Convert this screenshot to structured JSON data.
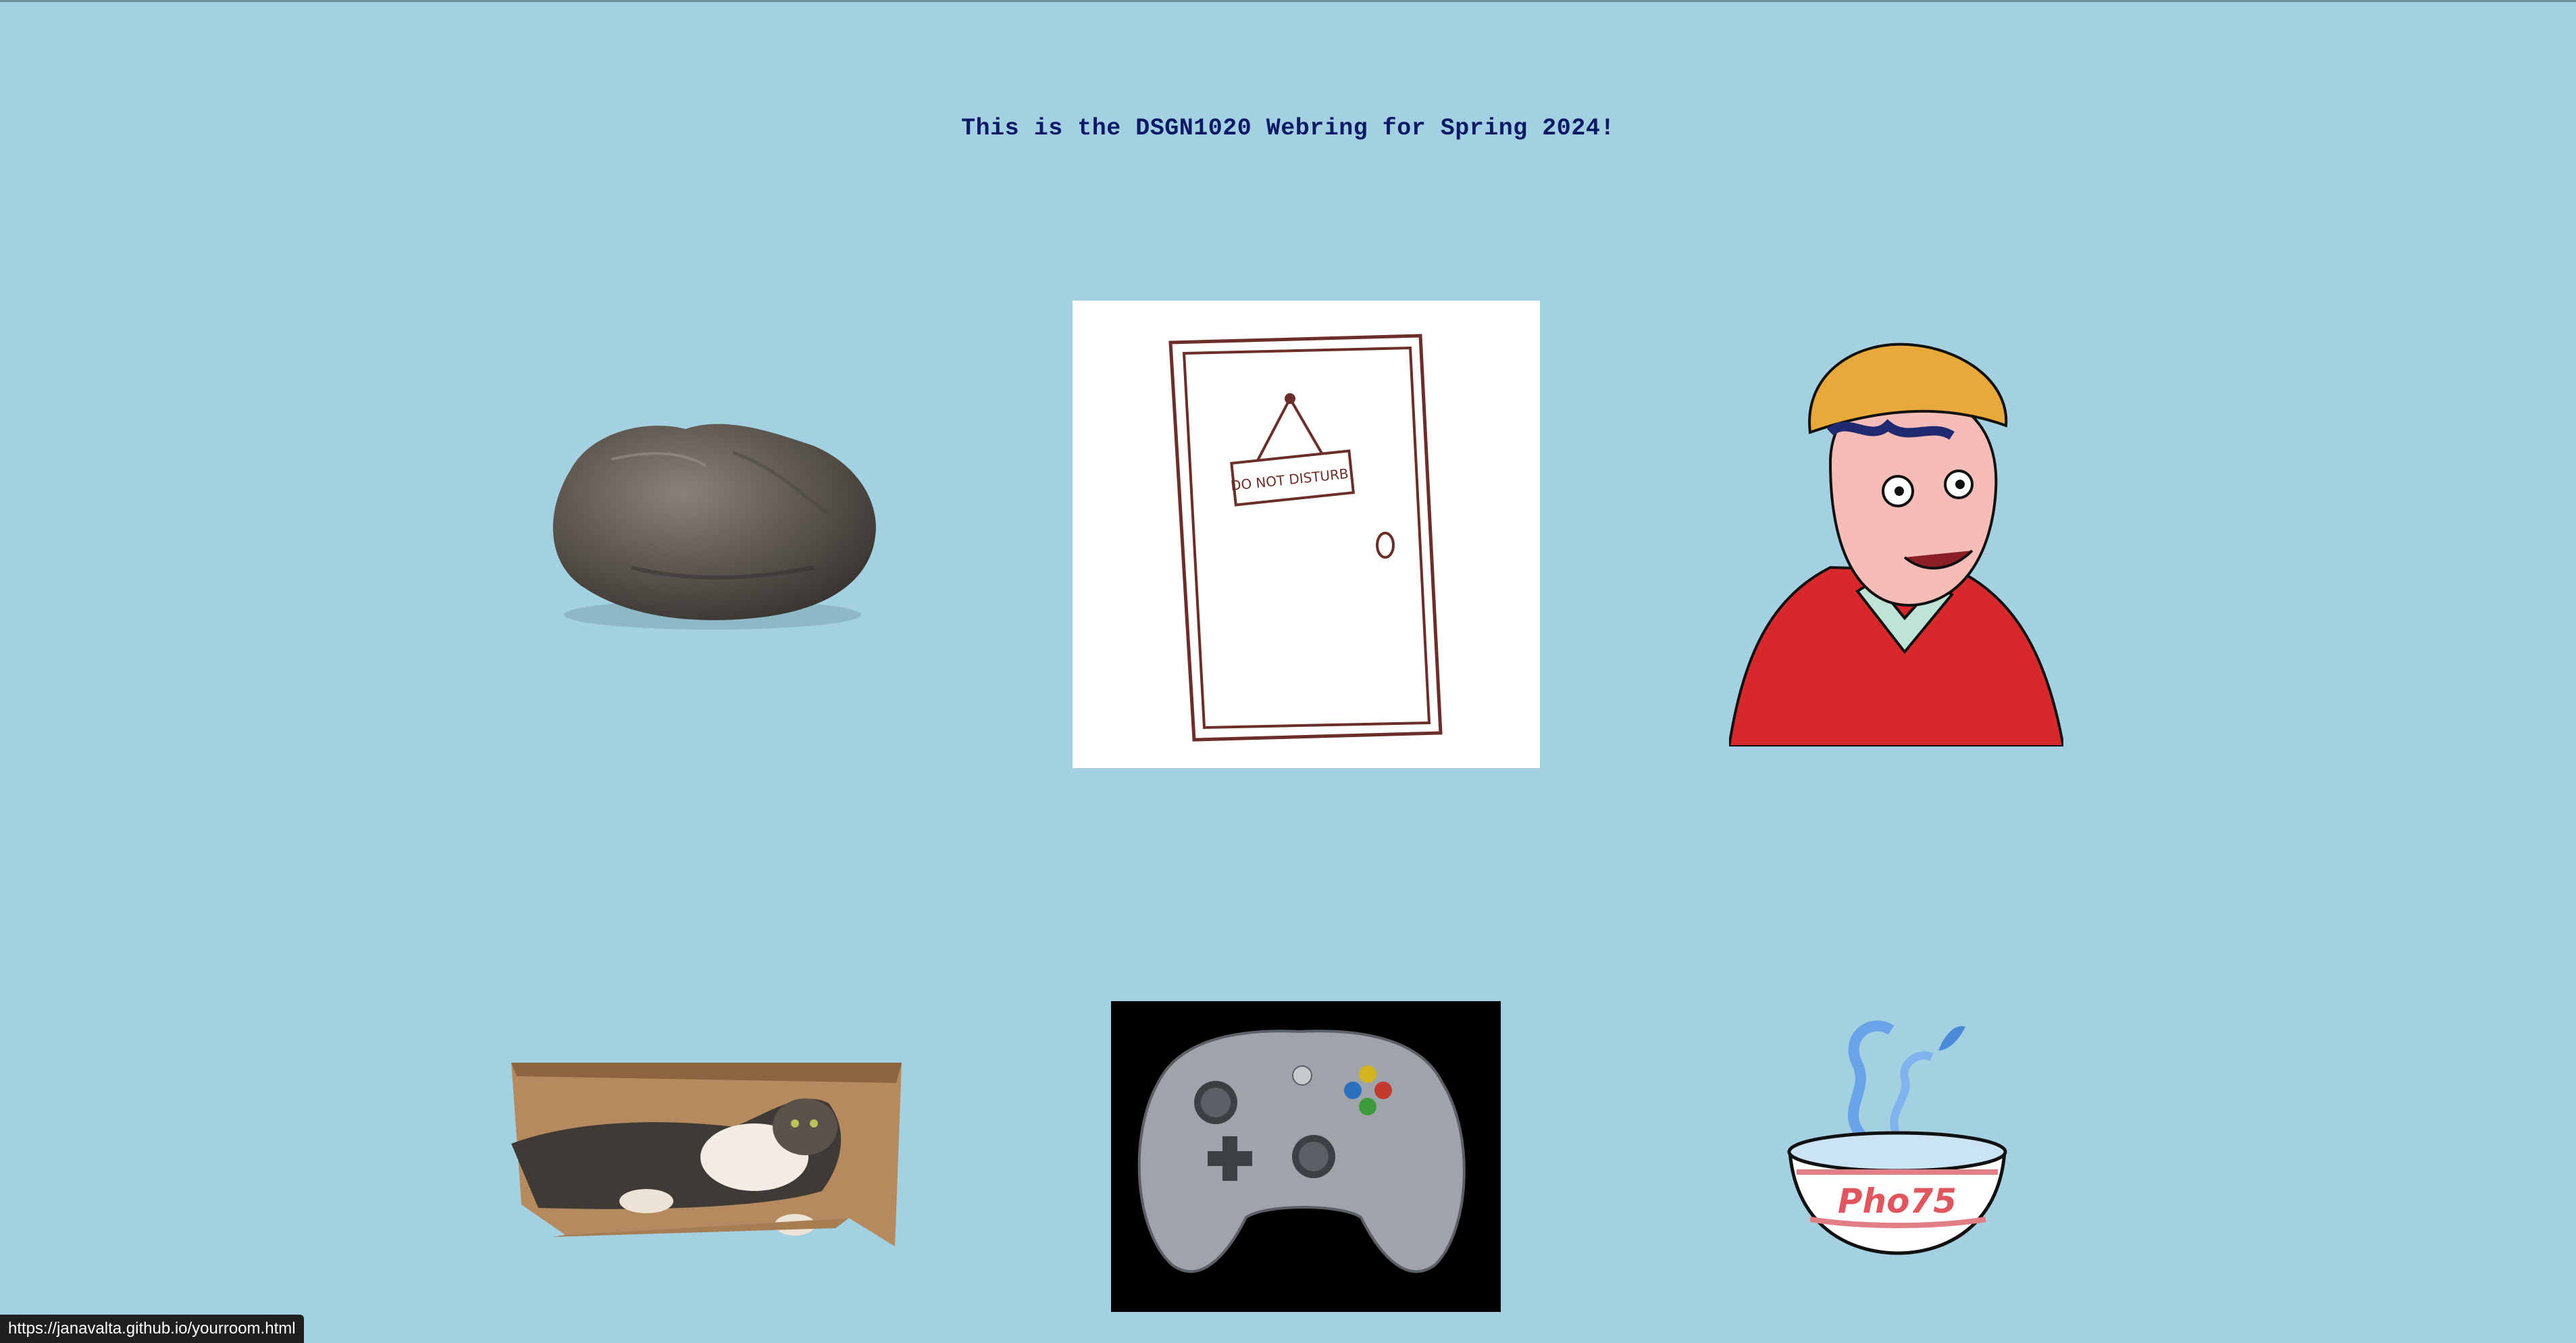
{
  "page": {
    "title": "This is the DSGN1020 Webring for Spring 2024!",
    "background_color": "#a4d1e1",
    "title_color": "#0a1a66"
  },
  "webring_tiles": [
    {
      "id": "rock",
      "depicts": "rock"
    },
    {
      "id": "door",
      "depicts": "door with do-not-disturb sign",
      "sign_text": "DO NOT DISTURB!"
    },
    {
      "id": "person",
      "depicts": "cartoon man in beanie"
    },
    {
      "id": "cat",
      "depicts": "cat in cardboard box"
    },
    {
      "id": "controller",
      "depicts": "game controller"
    },
    {
      "id": "pho",
      "depicts": "pho bowl",
      "bowl_text": "Pho75"
    }
  ],
  "status_bar": {
    "url": "https://janavalta.github.io/yourroom.html"
  }
}
